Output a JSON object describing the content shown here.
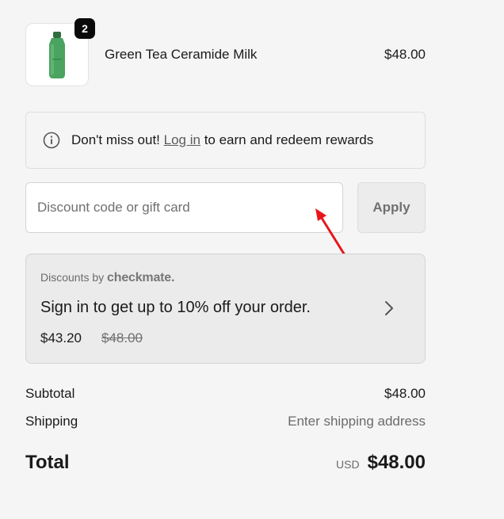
{
  "product": {
    "quantity": "2",
    "name": "Green Tea Ceramide Milk",
    "price": "$48.00"
  },
  "notice": {
    "prefix": "Don't miss out!",
    "link": "Log in",
    "suffix": "to earn and redeem rewards"
  },
  "discount": {
    "placeholder": "Discount code or gift card",
    "value": "",
    "apply_label": "Apply"
  },
  "offer": {
    "by_label": "Discounts by",
    "brand": "checkmate.",
    "title": "Sign in to get up to 10% off your order.",
    "new_price": "$43.20",
    "old_price": "$48.00"
  },
  "summary": {
    "subtotal_label": "Subtotal",
    "subtotal_value": "$48.00",
    "shipping_label": "Shipping",
    "shipping_value": "Enter shipping address",
    "total_label": "Total",
    "currency": "USD",
    "total_value": "$48.00"
  },
  "colors": {
    "background": "#f5f5f5",
    "annotation_arrow": "#e8161b",
    "badge": "#0a0a0a"
  },
  "icons": {
    "info": "info-circle-icon",
    "chevron": "chevron-right-icon",
    "arrow": "red-annotation-arrow"
  }
}
